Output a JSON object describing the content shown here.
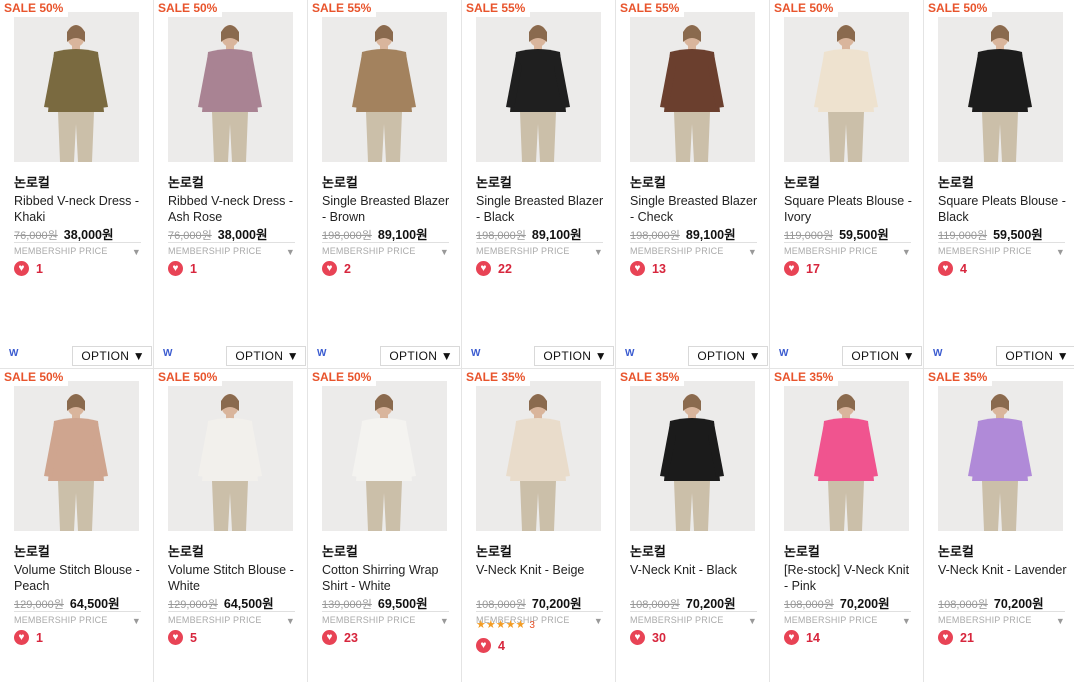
{
  "option_label": "OPTION ▼",
  "w_label": "W",
  "membership_label": "MEMBERSHIP PRICE",
  "products": [
    {
      "sale": "SALE 50%",
      "brand": "논로컬",
      "name": "Ribbed V-neck Dress - Khaki",
      "orig": "76,000원",
      "price": "38,000원",
      "likes": "1",
      "color": "#7a6a40"
    },
    {
      "sale": "SALE 50%",
      "brand": "논로컬",
      "name": "Ribbed V-neck Dress - Ash Rose",
      "orig": "76,000원",
      "price": "38,000원",
      "likes": "1",
      "color": "#a98393"
    },
    {
      "sale": "SALE 55%",
      "brand": "논로컬",
      "name": "Single Breasted Blazer - Brown",
      "orig": "198,000원",
      "price": "89,100원",
      "likes": "2",
      "color": "#a3825e"
    },
    {
      "sale": "SALE 55%",
      "brand": "논로컬",
      "name": "Single Breasted Blazer - Black",
      "orig": "198,000원",
      "price": "89,100원",
      "likes": "22",
      "color": "#1f1f1f"
    },
    {
      "sale": "SALE 55%",
      "brand": "논로컬",
      "name": "Single Breasted Blazer - Check",
      "orig": "198,000원",
      "price": "89,100원",
      "likes": "13",
      "color": "#6b3f2e"
    },
    {
      "sale": "SALE 50%",
      "brand": "논로컬",
      "name": "Square Pleats Blouse - Ivory",
      "orig": "119,000원",
      "price": "59,500원",
      "likes": "17",
      "color": "#eee2cf"
    },
    {
      "sale": "SALE 50%",
      "brand": "논로컬",
      "name": "Square Pleats Blouse - Black",
      "orig": "119,000원",
      "price": "59,500원",
      "likes": "4",
      "color": "#1c1c1c"
    },
    {
      "sale": "SALE 50%",
      "brand": "논로컬",
      "name": "Volume Stitch Blouse - Peach",
      "orig": "129,000원",
      "price": "64,500원",
      "likes": "1",
      "color": "#cfa58f"
    },
    {
      "sale": "SALE 50%",
      "brand": "논로컬",
      "name": "Volume Stitch Blouse - White",
      "orig": "129,000원",
      "price": "64,500원",
      "likes": "5",
      "color": "#f2f0ec"
    },
    {
      "sale": "SALE 50%",
      "brand": "논로컬",
      "name": "Cotton Shirring Wrap Shirt - White",
      "orig": "139,000원",
      "price": "69,500원",
      "likes": "23",
      "color": "#f4f3f0"
    },
    {
      "sale": "SALE 35%",
      "brand": "논로컬",
      "name": "V-Neck Knit - Beige",
      "orig": "108,000원",
      "price": "70,200원",
      "likes": "4",
      "color": "#e9dccb",
      "stars": "★★★★★",
      "star_count": "3"
    },
    {
      "sale": "SALE 35%",
      "brand": "논로컬",
      "name": "V-Neck Knit - Black",
      "orig": "108,000원",
      "price": "70,200원",
      "likes": "30",
      "color": "#1b1b1b"
    },
    {
      "sale": "SALE 35%",
      "brand": "논로컬",
      "name": "[Re-stock] V-Neck Knit - Pink",
      "orig": "108,000원",
      "price": "70,200원",
      "likes": "14",
      "color": "#f0548f"
    },
    {
      "sale": "SALE 35%",
      "brand": "논로컬",
      "name": "V-Neck Knit - Lavender",
      "orig": "108,000원",
      "price": "70,200원",
      "likes": "21",
      "color": "#b08ad8"
    }
  ]
}
